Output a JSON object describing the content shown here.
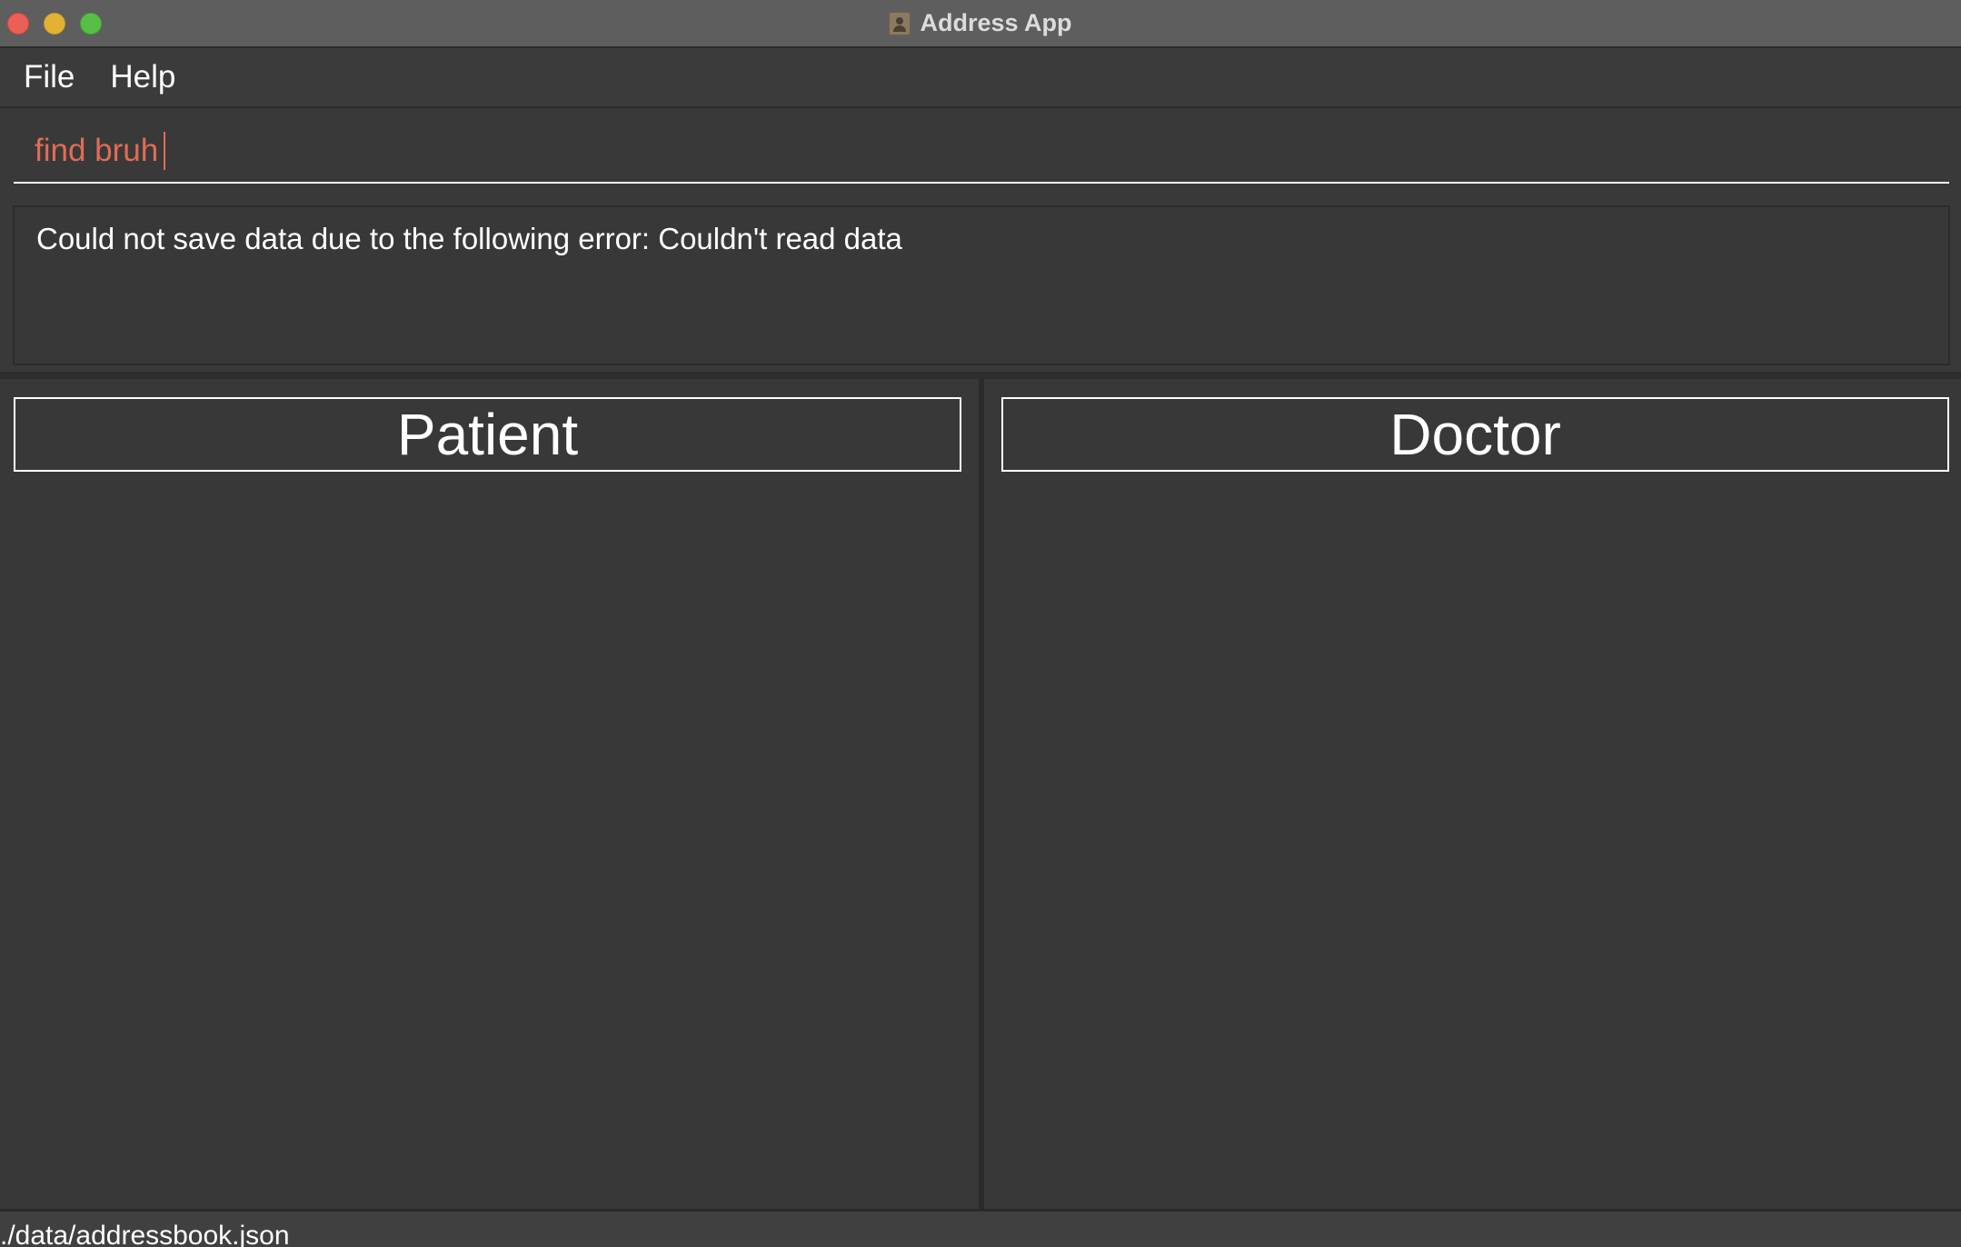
{
  "window": {
    "title": "Address App",
    "app_icon": "contacts-book-icon"
  },
  "menu": {
    "items": [
      {
        "label": "File"
      },
      {
        "label": "Help"
      }
    ]
  },
  "command": {
    "value": "find bruh",
    "text_color": "#e06c55"
  },
  "result": {
    "message": "Could not save data due to the following error: Couldn't read data"
  },
  "panels": {
    "patient": {
      "title": "Patient"
    },
    "doctor": {
      "title": "Doctor"
    }
  },
  "status": {
    "file_path": "./data/addressbook.json"
  },
  "colors": {
    "background": "#393939",
    "titlebar": "#5e5e5e",
    "close": "#ec5f57",
    "minimize": "#e3b234",
    "zoom": "#57bf45"
  }
}
